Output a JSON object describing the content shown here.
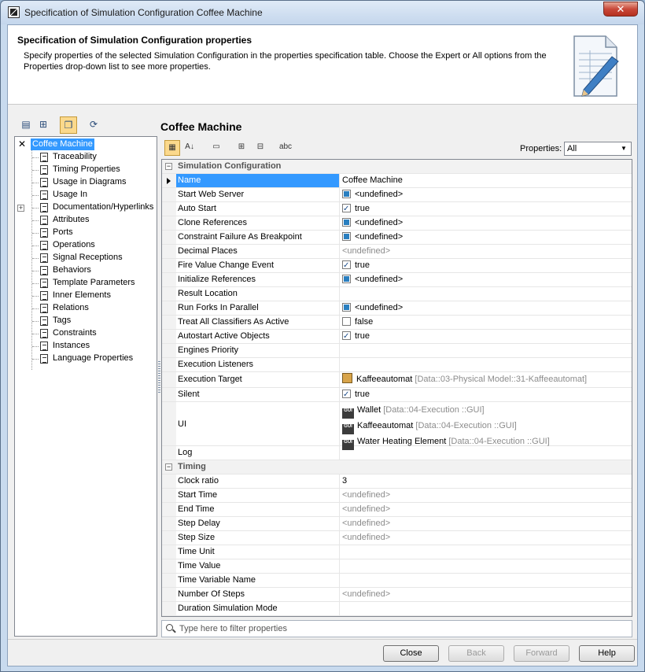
{
  "window": {
    "title": "Specification of Simulation Configuration Coffee Machine",
    "close_label": "✕"
  },
  "header": {
    "title": "Specification of Simulation Configuration properties",
    "description": "Specify properties of the selected Simulation Configuration in the properties specification table. Choose the Expert or All options from the Properties drop-down list to see more properties."
  },
  "tree": {
    "root": "Coffee Machine",
    "items": [
      "Traceability",
      "Timing Properties",
      "Usage in Diagrams",
      "Usage In",
      "Documentation/Hyperlinks",
      "Attributes",
      "Ports",
      "Operations",
      "Signal Receptions",
      "Behaviors",
      "Template Parameters",
      "Inner Elements",
      "Relations",
      "Tags",
      "Constraints",
      "Instances",
      "Language Properties"
    ]
  },
  "main": {
    "title": "Coffee Machine",
    "properties_label": "Properties:",
    "properties_value": "All"
  },
  "groups": {
    "simulation": "Simulation Configuration",
    "timing": "Timing"
  },
  "rows": {
    "name": {
      "label": "Name",
      "value": "Coffee Machine"
    },
    "start_web_server": {
      "label": "Start Web Server",
      "value": "<undefined>"
    },
    "auto_start": {
      "label": "Auto Start",
      "value": "true"
    },
    "clone_references": {
      "label": "Clone References",
      "value": "<undefined>"
    },
    "constraint_failure": {
      "label": "Constraint Failure As Breakpoint",
      "value": "<undefined>"
    },
    "decimal_places": {
      "label": "Decimal Places",
      "value": "<undefined>"
    },
    "fire_value_change": {
      "label": "Fire Value Change Event",
      "value": "true"
    },
    "initialize_references": {
      "label": "Initialize References",
      "value": "<undefined>"
    },
    "result_location": {
      "label": "Result Location",
      "value": ""
    },
    "run_forks": {
      "label": "Run Forks In Parallel",
      "value": "<undefined>"
    },
    "treat_all_classifiers": {
      "label": "Treat All Classifiers As Active",
      "value": "false"
    },
    "autostart_active": {
      "label": "Autostart Active Objects",
      "value": "true"
    },
    "engines_priority": {
      "label": "Engines Priority",
      "value": ""
    },
    "execution_listeners": {
      "label": "Execution Listeners",
      "value": ""
    },
    "execution_target": {
      "label": "Execution Target",
      "value": "Kaffeeautomat",
      "path": "[Data::03-Physical Model::31-Kaffeeautomat]"
    },
    "silent": {
      "label": "Silent",
      "value": "true"
    },
    "ui": {
      "label": "UI",
      "icon_text": "GUI",
      "items": [
        {
          "value": "Wallet",
          "path": "[Data::04-Execution ::GUI]"
        },
        {
          "value": "Kaffeeautomat",
          "path": "[Data::04-Execution ::GUI]"
        },
        {
          "value": "Water Heating Element",
          "path": "[Data::04-Execution ::GUI]"
        }
      ]
    },
    "log": {
      "label": "Log",
      "value": ""
    },
    "clock_ratio": {
      "label": "Clock ratio",
      "value": "3"
    },
    "start_time": {
      "label": "Start Time",
      "value": "<undefined>"
    },
    "end_time": {
      "label": "End Time",
      "value": "<undefined>"
    },
    "step_delay": {
      "label": "Step Delay",
      "value": "<undefined>"
    },
    "step_size": {
      "label": "Step Size",
      "value": "<undefined>"
    },
    "time_unit": {
      "label": "Time Unit",
      "value": ""
    },
    "time_value": {
      "label": "Time Value",
      "value": ""
    },
    "time_variable_name": {
      "label": "Time Variable Name",
      "value": ""
    },
    "number_of_steps": {
      "label": "Number Of Steps",
      "value": "<undefined>"
    },
    "duration_sim_mode": {
      "label": "Duration Simulation Mode",
      "value": ""
    }
  },
  "filter": {
    "placeholder": "Type here to filter properties"
  },
  "buttons": {
    "close": "Close",
    "back": "Back",
    "forward": "Forward",
    "help": "Help"
  }
}
